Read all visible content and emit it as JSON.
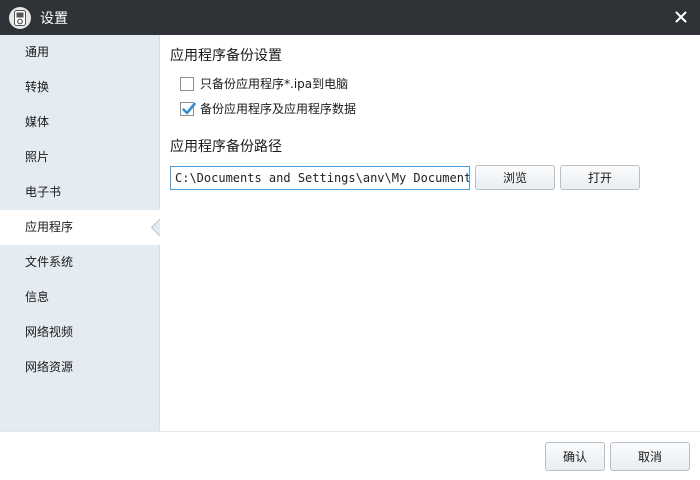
{
  "window": {
    "title": "设置",
    "close_icon": "close-icon",
    "app_icon": "ipod-icon"
  },
  "sidebar": {
    "items": [
      {
        "label": "通用"
      },
      {
        "label": "转换"
      },
      {
        "label": "媒体"
      },
      {
        "label": "照片"
      },
      {
        "label": "电子书"
      },
      {
        "label": "应用程序",
        "selected": true
      },
      {
        "label": "文件系统"
      },
      {
        "label": "信息"
      },
      {
        "label": "网络视频"
      },
      {
        "label": "网络资源"
      }
    ]
  },
  "main": {
    "backup_settings_title": "应用程序备份设置",
    "option_ipa_only": {
      "label": "只备份应用程序*.ipa到电脑",
      "checked": false
    },
    "option_with_data": {
      "label": "备份应用程序及应用程序数据",
      "checked": true
    },
    "backup_path_title": "应用程序备份路径",
    "backup_path_value": "C:\\Documents and Settings\\anv\\My Documents",
    "browse_label": "浏览",
    "open_label": "打开"
  },
  "footer": {
    "ok_label": "确认",
    "cancel_label": "取消"
  },
  "colors": {
    "titlebar": "#2f3337",
    "sidebar": "#e4ebf1",
    "accent": "#4a9fd8",
    "check": "#3a8fd0"
  }
}
